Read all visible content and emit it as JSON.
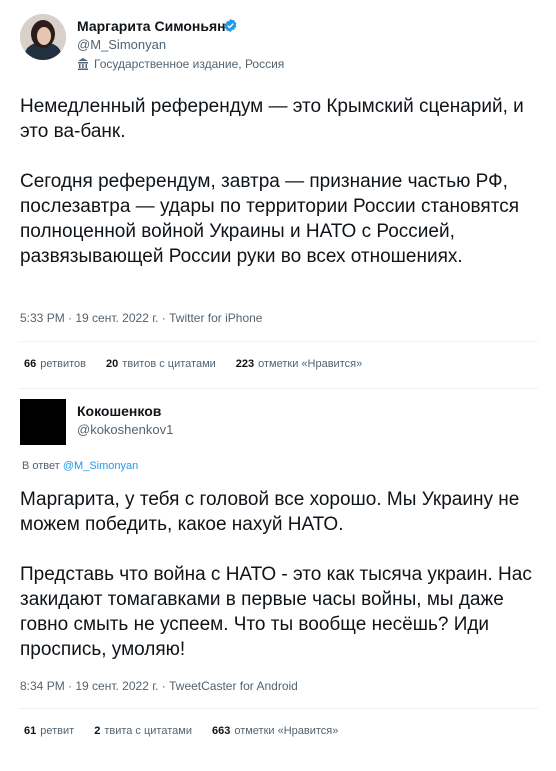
{
  "tweet1": {
    "name": "Маргарита Симоньян",
    "handle": "@M_Simonyan",
    "label": "Государственное издание, Россия",
    "text": "Немедленный референдум — это Крымский сценарий, и это ва-банк.\n\nСегодня референдум, завтра — признание частью РФ, послезавтра — удары по территории России становятся полноценной войной Украины и НАТО с Россией, развязывающей России руки во всех отношениях.",
    "timestamp": "5:33 PM · 19 сент. 2022 г. · Twitter for iPhone",
    "stats": [
      {
        "count": "66",
        "label": "ретвитов"
      },
      {
        "count": "20",
        "label": "твитов с цитатами"
      },
      {
        "count": "223",
        "label": "отметки «Нравится»"
      }
    ]
  },
  "tweet2": {
    "name": "Кокошенков",
    "handle": "@kokoshenkov1",
    "reply_prefix": "В ответ",
    "reply_handle": "@M_Simonyan",
    "text": "Маргарита, у тебя с головой все хорошо. Мы Украину не можем победить, какое нахуй НАТО.\n\nПредставь что война с НАТО - это как тысяча украин. Нас закидают томагавками в первые часы войны, мы даже говно смыть не успеем. Что ты вообще несёшь? Иди проспись, умоляю!",
    "timestamp": "8:34 PM · 19 сент. 2022 г. · TweetCaster for Android",
    "stats": [
      {
        "count": "61",
        "label": "ретвит"
      },
      {
        "count": "2",
        "label": "твита с цитатами"
      },
      {
        "count": "663",
        "label": "отметки «Нравится»"
      }
    ]
  },
  "colors": {
    "verified": "#1d9bf0",
    "link": "#1d9bf0",
    "secondary": "#536471"
  }
}
